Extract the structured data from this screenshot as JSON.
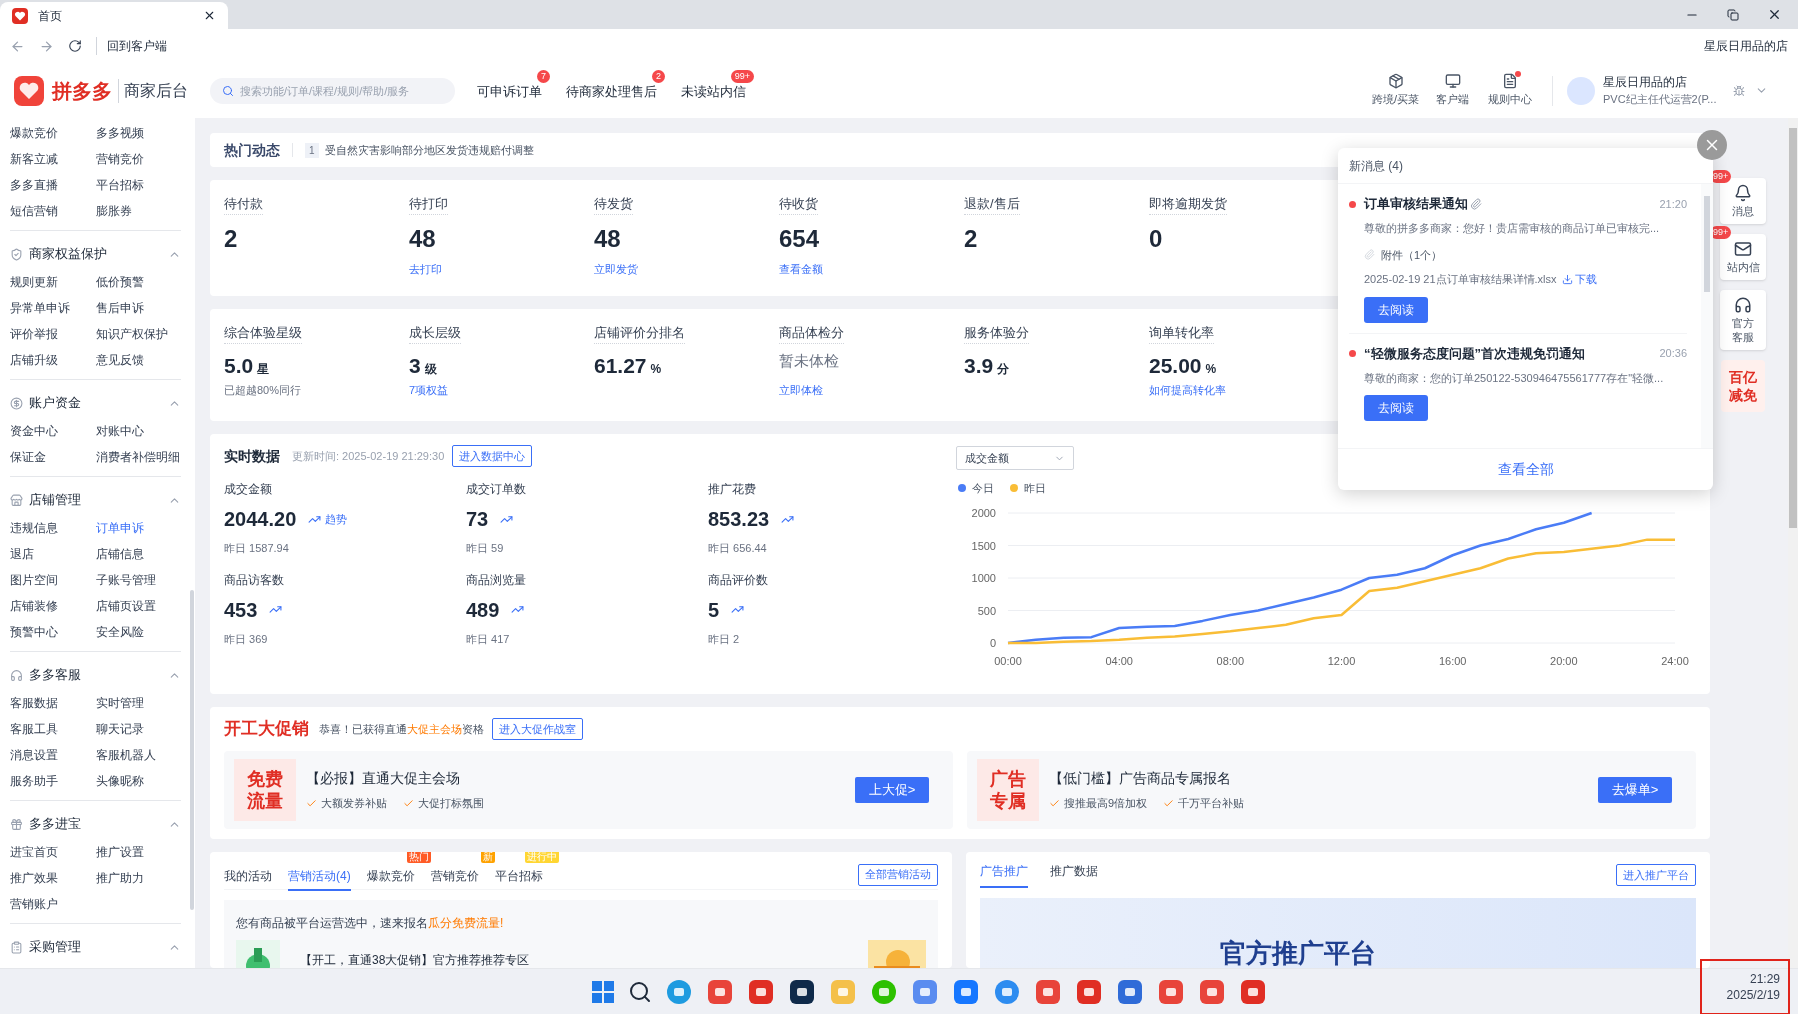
{
  "browser": {
    "tab_title": "首页",
    "back_to_client": "回到客户端",
    "shop_name": "星辰日用品的店"
  },
  "header": {
    "brand": "拼多多",
    "subtitle": "商家后台",
    "search": {
      "placeholder": "搜索功能/订单/课程/规则/帮助/服务"
    },
    "links": [
      {
        "label": "可申诉订单",
        "badge": "7"
      },
      {
        "label": "待商家处理售后",
        "badge": "2"
      },
      {
        "label": "未读站内信",
        "badge": "99+"
      }
    ],
    "tools": [
      {
        "label": "跨境/买菜",
        "dot": false
      },
      {
        "label": "客户端",
        "dot": false
      },
      {
        "label": "规则中心",
        "dot": true
      }
    ],
    "user": {
      "name": "星辰日用品的店",
      "role": "PVC纪主任代运营2(P..."
    }
  },
  "sidebar": {
    "sections": [
      {
        "items": [
          {
            "label": "爆款竞价",
            "selected": false
          },
          {
            "label": "多多视频",
            "selected": false
          },
          {
            "label": "新客立减",
            "selected": false
          },
          {
            "label": "营销竞价",
            "selected": false
          },
          {
            "label": "多多直播",
            "selected": false
          },
          {
            "label": "平台招标",
            "selected": false
          },
          {
            "label": "短信营销",
            "selected": false
          },
          {
            "label": "膨胀券",
            "selected": false
          }
        ]
      },
      {
        "title": "商家权益保护",
        "expanded": true,
        "items": [
          {
            "label": "规则更新",
            "selected": false
          },
          {
            "label": "低价预警",
            "selected": false
          },
          {
            "label": "异常单申诉",
            "selected": false
          },
          {
            "label": "售后申诉",
            "selected": false
          },
          {
            "label": "评价举报",
            "selected": false
          },
          {
            "label": "知识产权保护",
            "selected": false
          },
          {
            "label": "店铺升级",
            "selected": false
          },
          {
            "label": "意见反馈",
            "selected": false
          }
        ]
      },
      {
        "title": "账户资金",
        "expanded": true,
        "items": [
          {
            "label": "资金中心",
            "selected": false
          },
          {
            "label": "对账中心",
            "selected": false
          },
          {
            "label": "保证金",
            "selected": false
          },
          {
            "label": "消费者补偿明细",
            "selected": false
          }
        ]
      },
      {
        "title": "店铺管理",
        "expanded": true,
        "items": [
          {
            "label": "违规信息",
            "selected": false
          },
          {
            "label": "订单申诉",
            "selected": true
          },
          {
            "label": "退店",
            "selected": false
          },
          {
            "label": "店铺信息",
            "selected": false
          },
          {
            "label": "图片空间",
            "selected": false
          },
          {
            "label": "子账号管理",
            "selected": false
          },
          {
            "label": "店铺装修",
            "selected": false
          },
          {
            "label": "店铺页设置",
            "selected": false
          },
          {
            "label": "预警中心",
            "selected": false
          },
          {
            "label": "安全风险",
            "selected": false
          }
        ]
      },
      {
        "title": "多多客服",
        "expanded": true,
        "items": [
          {
            "label": "客服数据",
            "selected": false
          },
          {
            "label": "实时管理",
            "selected": false
          },
          {
            "label": "客服工具",
            "selected": false
          },
          {
            "label": "聊天记录",
            "selected": false
          },
          {
            "label": "消息设置",
            "selected": false
          },
          {
            "label": "客服机器人",
            "selected": false
          },
          {
            "label": "服务助手",
            "selected": false
          },
          {
            "label": "头像昵称",
            "selected": false
          }
        ]
      },
      {
        "title": "多多进宝",
        "expanded": true,
        "items": [
          {
            "label": "进宝首页",
            "selected": false
          },
          {
            "label": "推广设置",
            "selected": false
          },
          {
            "label": "推广效果",
            "selected": false
          },
          {
            "label": "推广助力",
            "selected": false
          },
          {
            "label": "营销账户",
            "selected": false
          }
        ]
      },
      {
        "title": "采购管理",
        "expanded": true
      }
    ]
  },
  "news": {
    "title": "热门动态",
    "index": "1",
    "text": "受自然灾害影响部分地区发货违规赔付调整"
  },
  "orders": [
    {
      "label": "待付款",
      "value": "2"
    },
    {
      "label": "待打印",
      "value": "48",
      "link": "去打印"
    },
    {
      "label": "待发货",
      "value": "48",
      "link": "立即发货"
    },
    {
      "label": "待收货",
      "value": "654",
      "link": "查看金额"
    },
    {
      "label": "退款/售后",
      "value": "2"
    },
    {
      "label": "即将逾期发货",
      "value": "0"
    }
  ],
  "metrics": [
    {
      "label": "综合体验星级",
      "value": "5.0",
      "unit": "星",
      "note": "已超越80%同行"
    },
    {
      "label": "成长层级",
      "value": "3",
      "unit": "级",
      "link": "7项权益"
    },
    {
      "label": "店铺评价分排名",
      "value": "61.27",
      "unit": "%"
    },
    {
      "label": "商品体检分",
      "status": "暂未体检",
      "link": "立即体检"
    },
    {
      "label": "服务体验分",
      "value": "3.9",
      "unit": "分"
    },
    {
      "label": "询单转化率",
      "value": "25.00",
      "unit": "%",
      "link": "如何提高转化率"
    }
  ],
  "realtime": {
    "title": "实时数据",
    "updated": "更新时间: 2025-02-19 21:29:30",
    "button": "进入数据中心",
    "stats": [
      {
        "label": "成交金额",
        "value": "2044.20",
        "trend_text": "趋势",
        "yesterday": "昨日 1587.94"
      },
      {
        "label": "成交订单数",
        "value": "73",
        "yesterday": "昨日 59"
      },
      {
        "label": "推广花费",
        "value": "853.23",
        "yesterday": "昨日 656.44"
      },
      {
        "label": "商品访客数",
        "value": "453",
        "yesterday": "昨日 369"
      },
      {
        "label": "商品浏览量",
        "value": "489",
        "yesterday": "昨日 417"
      },
      {
        "label": "商品评价数",
        "value": "5",
        "yesterday": "昨日 2"
      }
    ],
    "dropdown": "成交金额",
    "chart_data": {
      "type": "line",
      "x": [
        0,
        1,
        2,
        3,
        4,
        5,
        6,
        7,
        8,
        9,
        10,
        11,
        12,
        13,
        14,
        15,
        16,
        17,
        18,
        19,
        20,
        21,
        22,
        23,
        24
      ],
      "xticks": [
        {
          "value": 0,
          "label": "00:00"
        },
        {
          "value": 4,
          "label": "04:00"
        },
        {
          "value": 8,
          "label": "08:00"
        },
        {
          "value": 12,
          "label": "12:00"
        },
        {
          "value": 16,
          "label": "16:00"
        },
        {
          "value": 20,
          "label": "20:00"
        },
        {
          "value": 24,
          "label": "24:00"
        }
      ],
      "yticks": [
        0,
        500,
        1000,
        1500,
        2000
      ],
      "xlim": [
        0,
        24
      ],
      "ylim": [
        0,
        2000
      ],
      "grid": true,
      "series": [
        {
          "name": "今日",
          "color": "#4a7cf6",
          "values": [
            0,
            50,
            80,
            90,
            230,
            250,
            260,
            340,
            430,
            500,
            600,
            700,
            820,
            1000,
            1050,
            1150,
            1350,
            1500,
            1600,
            1750,
            1850,
            2000,
            null,
            null,
            null
          ]
        },
        {
          "name": "昨日",
          "color": "#f9bd36",
          "values": [
            0,
            0,
            20,
            30,
            50,
            80,
            100,
            140,
            180,
            230,
            280,
            380,
            430,
            800,
            850,
            950,
            1050,
            1150,
            1300,
            1380,
            1400,
            1450,
            1500,
            1590,
            1590
          ]
        }
      ]
    }
  },
  "promo": {
    "title": "开工大促销",
    "notice_before": "恭喜！已获得直通",
    "notice_highlight": "大促主会场",
    "notice_after": "资格",
    "button": "进入大促作战室",
    "panels": [
      {
        "badge": [
          "免费",
          "流量"
        ],
        "title": "【必报】直通大促主会场",
        "perks": [
          "大额发券补贴",
          "大促打标氛围"
        ],
        "button": "上大促>"
      },
      {
        "badge": [
          "广告",
          "专属"
        ],
        "title": "【低门槛】广告商品专属报名",
        "perks": [
          "搜推最高9倍加权",
          "千万平台补贴"
        ],
        "button": "去爆单>"
      }
    ]
  },
  "activities": {
    "tabs": [
      {
        "label": "我的活动",
        "selected": false
      },
      {
        "label": "营销活动(4)",
        "selected": true
      },
      {
        "label": "爆款竞价",
        "selected": false,
        "tag": {
          "text": "热门",
          "color": "#ff5b26"
        }
      },
      {
        "label": "营销竞价",
        "selected": false,
        "tag": {
          "text": "新",
          "color": "#ffa200"
        }
      },
      {
        "label": "平台招标",
        "selected": false,
        "tag": {
          "text": "进行中",
          "color": "#ffd633"
        }
      }
    ],
    "button": "全部营销活动",
    "notice_before": "您有商品被平台运营选中，速来报名",
    "notice_highlight": "瓜分免费流量!",
    "item": "【开工，直通38大促销】官方推荐推荐专区"
  },
  "ads": {
    "tabs": [
      {
        "label": "广告推广",
        "selected": true
      },
      {
        "label": "推广数据",
        "selected": false
      }
    ],
    "button": "进入推广平台",
    "banner": "官方推广平台"
  },
  "messages": {
    "title": "新消息 (4)",
    "footer": "查看全部",
    "items": [
      {
        "title": "订单审核结果通知",
        "unread": true,
        "time": "21:20",
        "body": "尊敬的拼多多商家：您好！贵店需审核的商品订单已审核完...",
        "attachment": {
          "label": "附件（1个）",
          "file": "2025-02-19 21点订单审核结果详情.xlsx",
          "download": "下载"
        },
        "button": "去阅读"
      },
      {
        "title": "“轻微服务态度问题”首次违规免罚通知",
        "unread": true,
        "time": "20:36",
        "body": "尊敬的商家：您的订单250122-530946475561777存在\"轻微...",
        "button": "去阅读"
      }
    ]
  },
  "side_tools": [
    {
      "label": "消息",
      "badge": "99+"
    },
    {
      "label": "站内信",
      "badge": "99+"
    },
    {
      "label": "官方客服"
    }
  ],
  "side_promo": [
    "百亿",
    "减免"
  ],
  "clock": {
    "time": "21:29",
    "date": "2025/2/19"
  }
}
